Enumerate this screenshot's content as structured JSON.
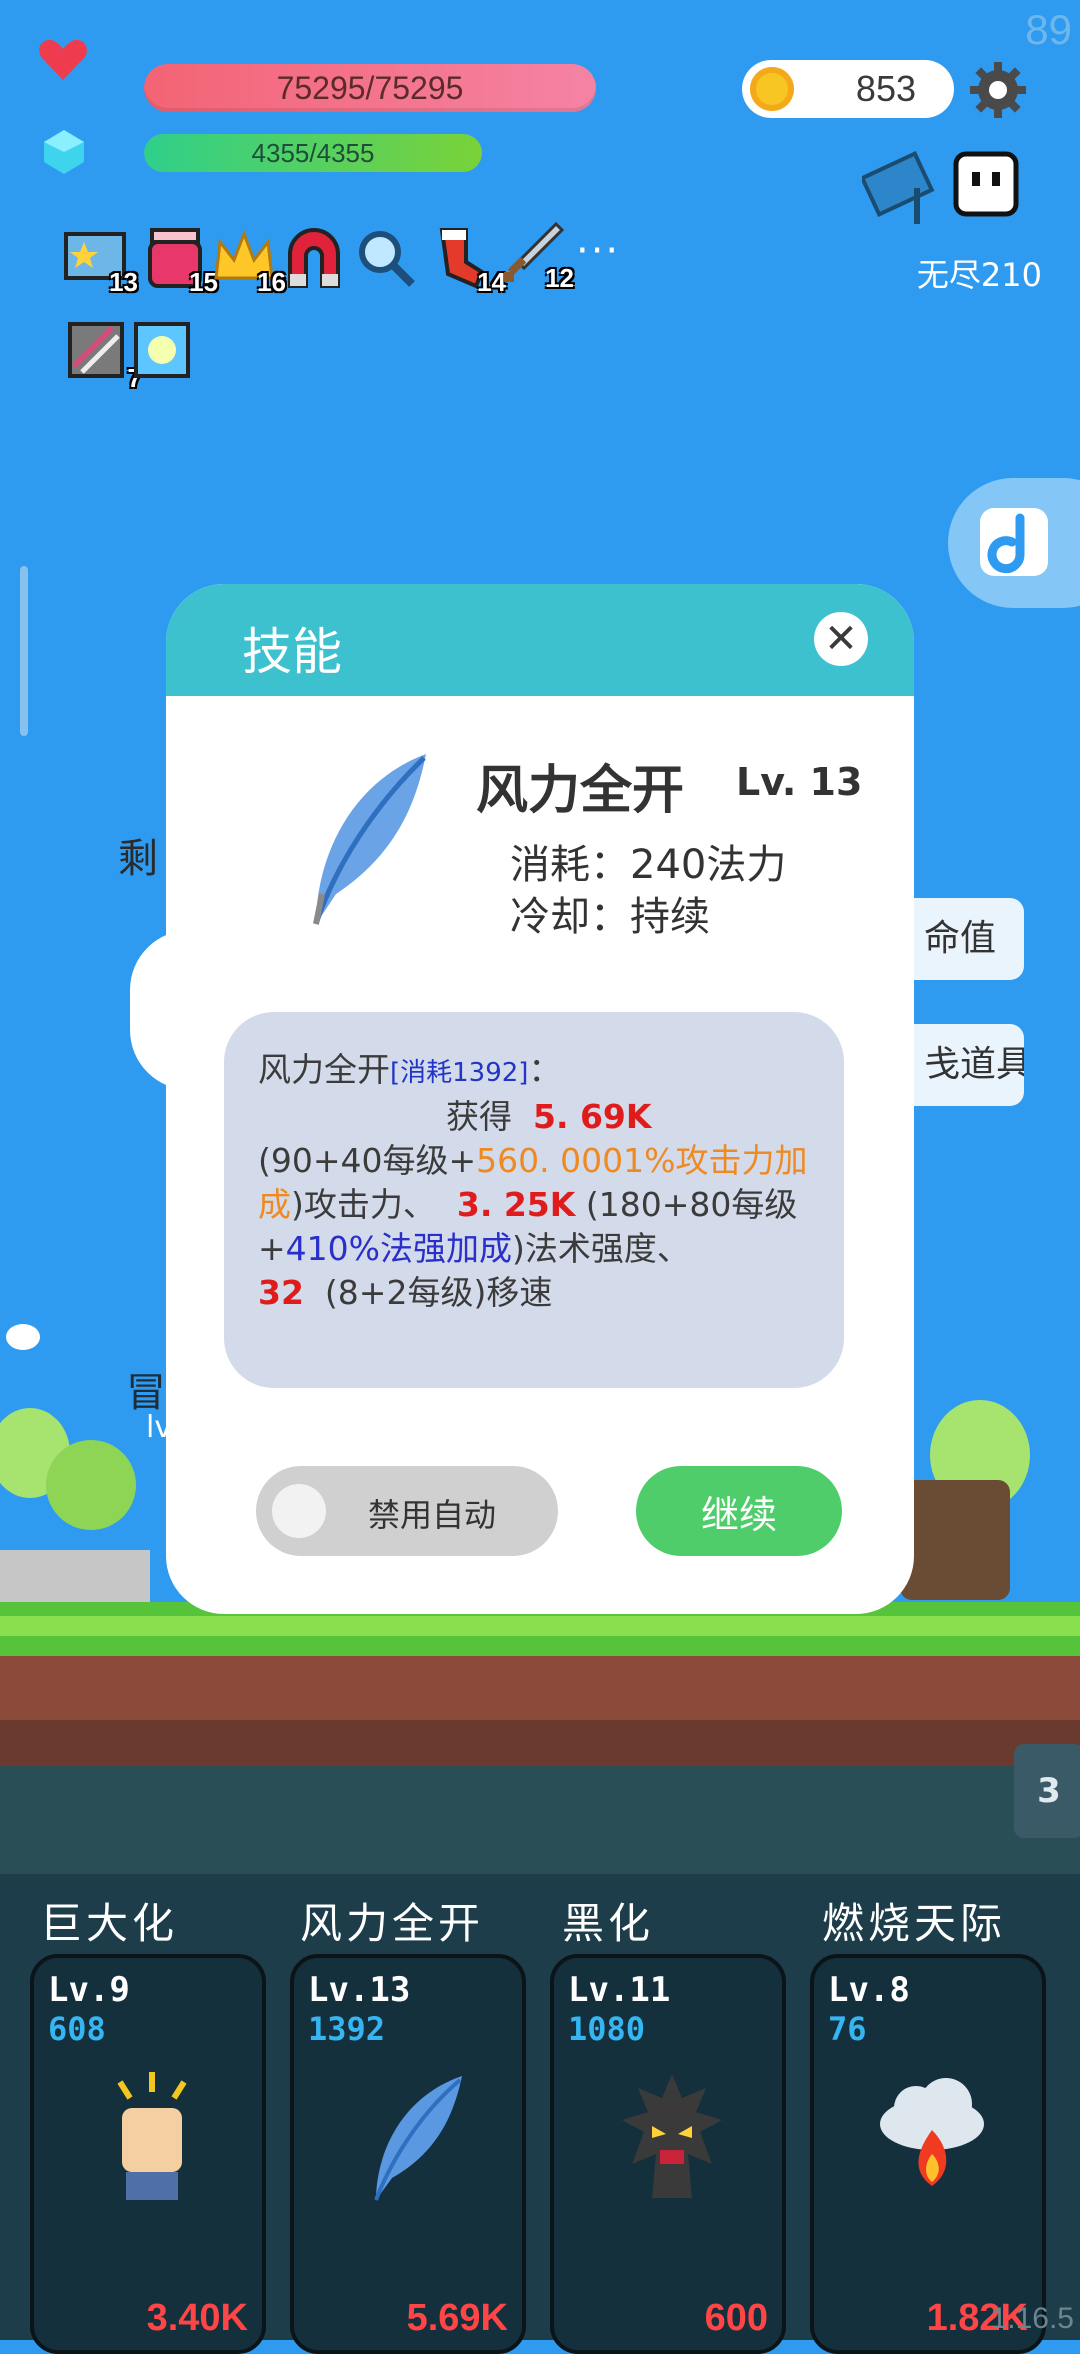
{
  "hud": {
    "fps": "89",
    "hp_text": "75295/75295",
    "mp_text": "4355/4355",
    "coins": "853",
    "endless_label": "无尽210",
    "buffs": [
      {
        "icon": "star-card-icon",
        "count": "13"
      },
      {
        "icon": "jam-jar-icon",
        "count": "15"
      },
      {
        "icon": "crown-icon",
        "count": "16"
      },
      {
        "icon": "magnet-icon",
        "count": ""
      },
      {
        "icon": "magnifier-icon",
        "count": ""
      },
      {
        "icon": "sock-icon",
        "count": "14"
      },
      {
        "icon": "sword-icon",
        "count": "12"
      },
      {
        "icon": "striped-card-icon",
        "count": "7"
      },
      {
        "icon": "glow-card-icon",
        "count": ""
      }
    ],
    "more_label": "···"
  },
  "background": {
    "left_text_1": "剩",
    "left_text_2": "冒",
    "left_text_3": "lv",
    "side_card_1": "命值",
    "side_card_2": "戋道具",
    "page_tag": "3"
  },
  "modal": {
    "title": "技能",
    "close_label": "✕",
    "skill_name": "风力全开",
    "skill_level": "Lv. 13",
    "cost_line": "消耗：240法力",
    "cooldown_line": "冷却：持续",
    "desc": {
      "name": "风力全开",
      "cost_tag": "[消耗1392]",
      "colon": "：",
      "gain": "获得",
      "atk_value": "5. 69K",
      "formula1_a": "(90+40每级+",
      "formula1_b": "560. 0001%攻击力加成",
      "formula1_c": ")攻击力、",
      "mag_value": "3. 25K",
      "formula2_a": "(180+80每级+",
      "formula2_b": "410%法强加成",
      "formula2_c": ")法术强度、",
      "spd_value": "32",
      "formula3": "(8+2每级)移速"
    },
    "toggle_label": "禁用自动",
    "continue_label": "继续"
  },
  "skills": [
    {
      "name": "巨大化",
      "level": "Lv.9",
      "cost": "608",
      "power": "3.40K",
      "icon": "fist-icon"
    },
    {
      "name": "风力全开",
      "level": "Lv.13",
      "cost": "1392",
      "power": "5.69K",
      "icon": "feather-icon"
    },
    {
      "name": "黑化",
      "level": "Lv.11",
      "cost": "1080",
      "power": "600",
      "icon": "dark-tree-icon"
    },
    {
      "name": "燃烧天际",
      "level": "Lv.8",
      "cost": "76",
      "power": "1.82K",
      "icon": "fire-cloud-icon"
    }
  ],
  "version": "1.16.5",
  "colors": {
    "sky": "#2f9bf0",
    "hp_bar": "#f36474",
    "mp_bar": "#2fcf8b",
    "modal_header": "#3ec1cf",
    "continue_button": "#4ecd6a",
    "value_red": "#e01b1b",
    "cost_blue": "#35b6f2"
  }
}
